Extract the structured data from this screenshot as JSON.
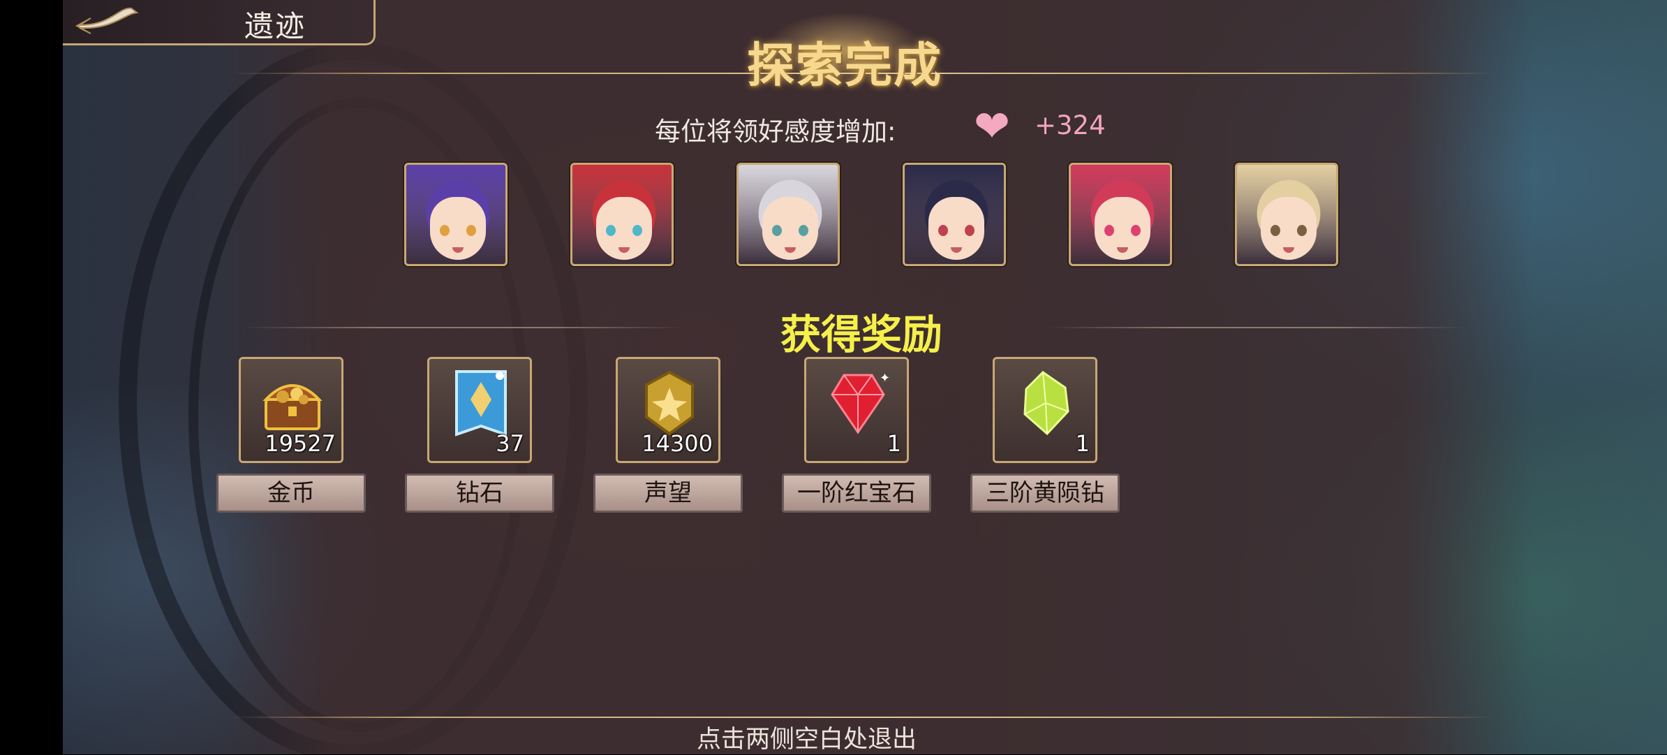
{
  "header": {
    "title": "遗迹"
  },
  "panel": {
    "title": "探索完成"
  },
  "favor": {
    "label": "每位将领好感度增加:",
    "value": "+324"
  },
  "heroes": [
    {
      "hair": "#5b3fa8",
      "eye": "#e0a040"
    },
    {
      "hair": "#c8323a",
      "eye": "#4fb8c8"
    },
    {
      "hair": "#d8d6dc",
      "eye": "#5aa0a0"
    },
    {
      "hair": "#2b2a48",
      "eye": "#c04050"
    },
    {
      "hair": "#d23a5a",
      "eye": "#e04070"
    },
    {
      "hair": "#e3cfa0",
      "eye": "#7a6040"
    }
  ],
  "rewards_title": "获得奖励",
  "rewards": [
    {
      "icon": "treasure-chest-icon",
      "count": "19527",
      "label": "金币",
      "color": "#d8a236"
    },
    {
      "icon": "diamond-card-icon",
      "count": "37",
      "label": "钻石",
      "color": "#3c9ad8"
    },
    {
      "icon": "gold-badge-icon",
      "count": "14300",
      "label": "声望",
      "color": "#c8a030"
    },
    {
      "icon": "red-gem-icon",
      "count": "1",
      "label": "一阶红宝石",
      "color": "#e02030"
    },
    {
      "icon": "yellow-green-crystal-icon",
      "count": "1",
      "label": "三阶黄陨钻",
      "color": "#b8e040"
    }
  ],
  "footer": {
    "hint": "点击两侧空白处退出"
  }
}
